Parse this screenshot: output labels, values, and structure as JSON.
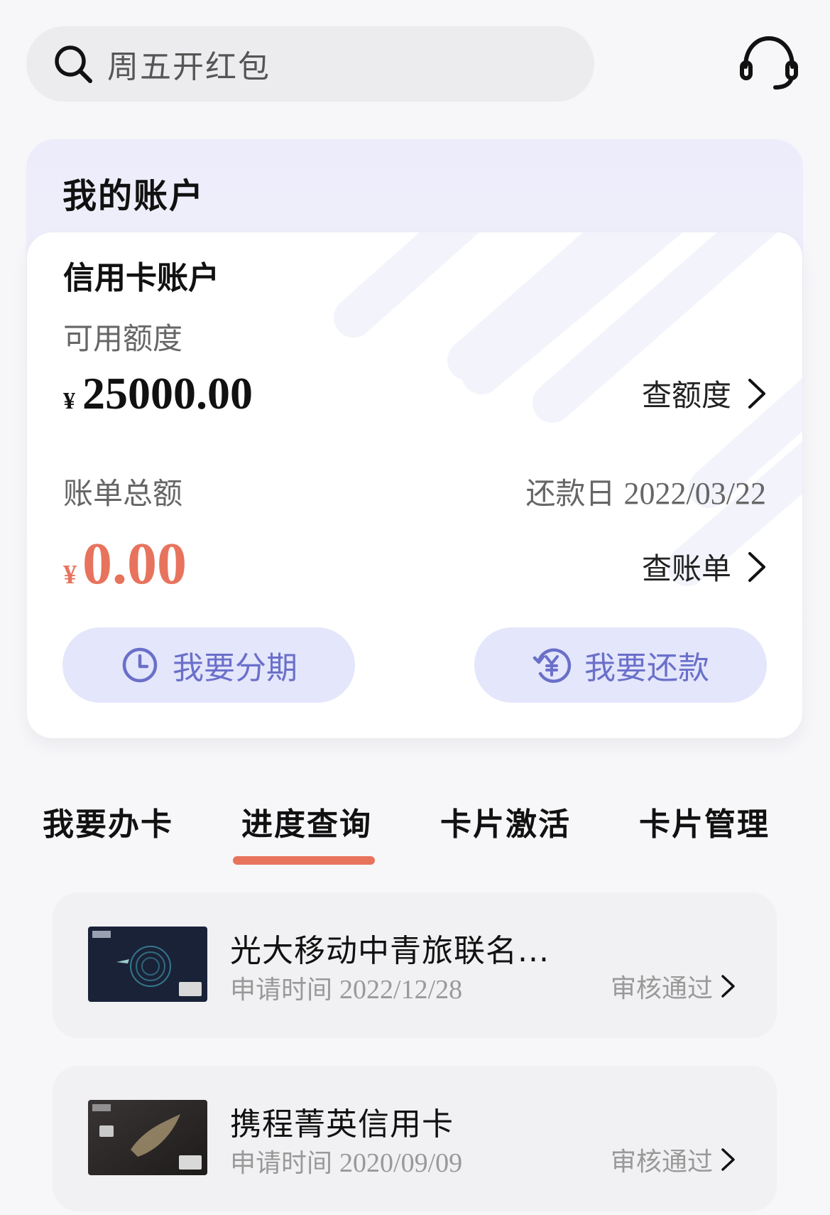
{
  "search": {
    "placeholder": "周五开红包"
  },
  "icons": {
    "search": "search-icon",
    "support": "headset-icon",
    "chevron": "chevron-right-icon",
    "installment": "clock-icon",
    "repay": "yuan-refresh-icon"
  },
  "account": {
    "section_title": "我的账户",
    "card_title": "信用卡账户",
    "available_label": "可用额度",
    "currency": "¥",
    "available_amount": "25000.00",
    "check_limit_label": "查额度",
    "bill_label": "账单总额",
    "due_label": "还款日",
    "due_date": "2022/03/22",
    "bill_amount": "0.00",
    "check_bill_label": "查账单",
    "installment_button": "我要分期",
    "repay_button": "我要还款"
  },
  "tabs": [
    {
      "label": "我要办卡"
    },
    {
      "label": "进度查询",
      "active": true
    },
    {
      "label": "卡片激活"
    },
    {
      "label": "卡片管理"
    }
  ],
  "applications": [
    {
      "name": "光大移动中青旅联名...",
      "date_label": "申请时间",
      "date": "2022/12/28",
      "status": "审核通过"
    },
    {
      "name": "携程菁英信用卡",
      "date_label": "申请时间",
      "date": "2020/09/09",
      "status": "审核通过"
    }
  ],
  "colors": {
    "accent": "#e8735d",
    "button_bg": "#e4e6fb",
    "button_text": "#6a70c9"
  }
}
